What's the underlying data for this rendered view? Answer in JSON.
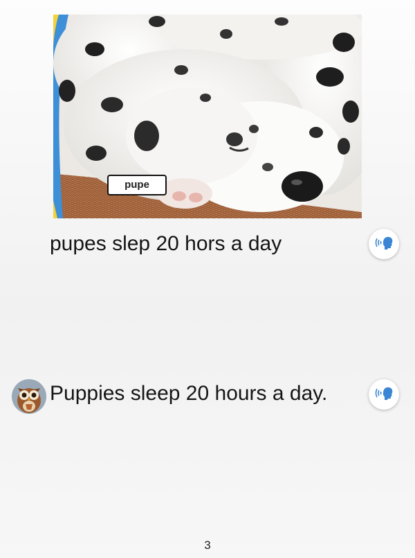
{
  "photo": {
    "subject": "sleeping dalmatian puppies",
    "label": "pupe"
  },
  "student_sentence": "pupes slep 20 hors a day",
  "model_sentence": "Puppies sleep 20 hours a day.",
  "audio_icon": "speaking-head-icon",
  "avatar_icon": "owl-icon",
  "page_number": "3",
  "colors": {
    "audio_icon": "#3a86d4",
    "button_bg": "#ffffff",
    "frame_blue": "#3d8fd8",
    "frame_yellow": "#f3d23c"
  }
}
